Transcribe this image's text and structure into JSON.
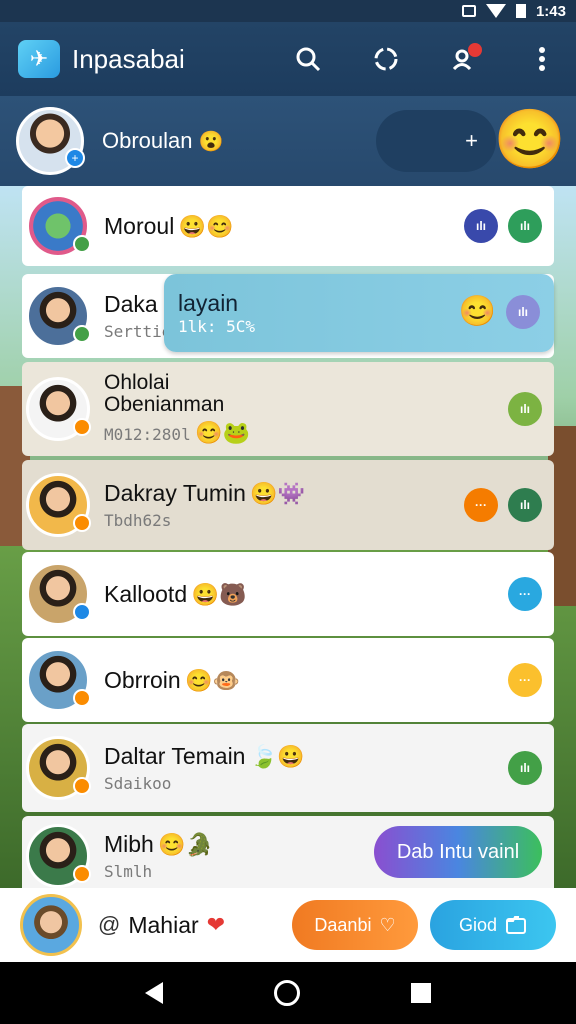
{
  "status_bar": {
    "time": "1:43"
  },
  "app_bar": {
    "title": "Inpasabai",
    "logo_glyph": "✈"
  },
  "profile_bar": {
    "name": "Obroulan",
    "name_emoji": "😮",
    "action_glyph": "+",
    "sticker": "😊"
  },
  "chats": [
    {
      "name": "Moroul",
      "sub": "",
      "emojis": "😀😊",
      "status_color": "#43a047",
      "badges": [
        {
          "text": "ılı",
          "color": "#3949ab"
        },
        {
          "text": "ılı",
          "color": "#2e9e5b"
        }
      ]
    },
    {
      "name": "Daka",
      "sub": "Serttie",
      "emojis": "",
      "status_color": "#43a047",
      "badges": []
    },
    {
      "name": "Ohlolai\nObenianman",
      "sub": "M012:280l",
      "emojis": "😊🐸",
      "status_color": "#fb8c00",
      "badges": [
        {
          "text": "ılı",
          "color": "#7cb342"
        }
      ]
    },
    {
      "name": "Dakray Tumin",
      "sub": "Tbdh62s",
      "emojis": "😀👾",
      "status_color": "#fb8c00",
      "badges": [
        {
          "text": "···",
          "color": "#f57c00"
        },
        {
          "text": "ılı",
          "color": "#2e7d4f"
        }
      ]
    },
    {
      "name": "Kallootd",
      "sub": "",
      "emojis": "😀🐻",
      "status_color": "#1e88e5",
      "badges": [
        {
          "text": "···",
          "color": "#29a8e0"
        }
      ]
    },
    {
      "name": "Obrroin",
      "sub": "",
      "emojis": "😊🐵",
      "status_color": "#fb8c00",
      "badges": [
        {
          "text": "···",
          "color": "#fbc02d"
        }
      ]
    },
    {
      "name": "Daltar Temain",
      "sub": "Sdaikoo",
      "emojis": "🍃😀",
      "status_color": "#fb8c00",
      "badges": [
        {
          "text": "ılı",
          "color": "#43a047"
        }
      ]
    },
    {
      "name": "Mibh",
      "sub": "Slmlh",
      "emojis": "😊🐊",
      "status_color": "#fb8c00",
      "badges": []
    }
  ],
  "bubble": {
    "title": "layain",
    "sub": "1lk: 5C%",
    "emoji": "😊",
    "badge_text": "ılı"
  },
  "fab_chip": {
    "label": "Dab Intu vainl"
  },
  "bottom_bar": {
    "at_symbol": "@",
    "name": "Mahiar",
    "emoji": "❤",
    "primary_button": "Daanbi",
    "secondary_button": "Giod"
  },
  "colors": {
    "appbar": "#1d3c5e",
    "accent_orange": "#f07a22",
    "accent_blue": "#2aa3e0"
  }
}
